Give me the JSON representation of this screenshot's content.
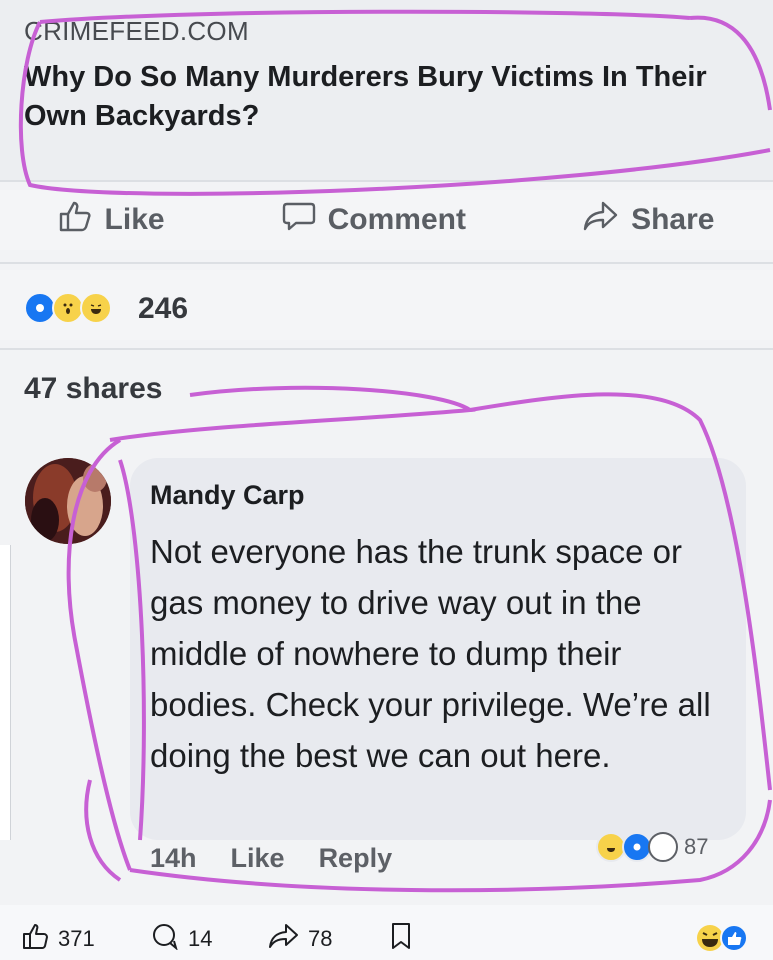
{
  "link_preview": {
    "source": "CRIMEFEED.COM",
    "title": "Why Do So Many Murderers Bury Victims In Their Own Backyards?"
  },
  "actions": {
    "like": "Like",
    "comment": "Comment",
    "share": "Share"
  },
  "reactions": {
    "icons": [
      "like-reaction-icon",
      "wow-reaction-icon",
      "haha-reaction-icon"
    ],
    "count": "246"
  },
  "shares_text": "47 shares",
  "comment": {
    "author": "Mandy Carp",
    "text": "Not everyone has the trunk space or gas money to drive way out in the middle of nowhere to dump their bodies. Check your privilege. We’re all doing the best we can out here.",
    "time": "14h",
    "like": "Like",
    "reply": "Reply",
    "reaction_count": "87"
  },
  "bottom_bar": {
    "likes": "371",
    "comments": "14",
    "shares": "78"
  },
  "colors": {
    "annotation": "#c760d4",
    "like_blue": "#1877f2",
    "haha_yellow": "#f7d24a"
  }
}
